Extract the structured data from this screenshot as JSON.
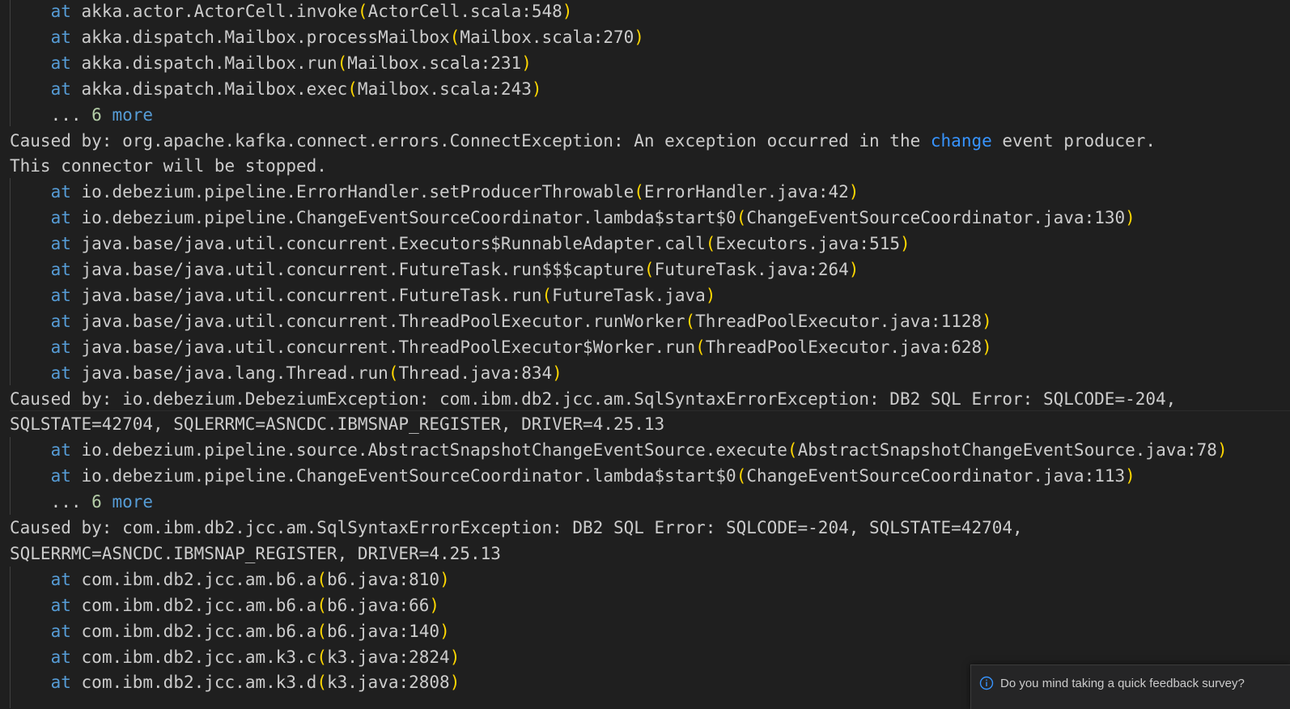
{
  "colors": {
    "background": "#1f1f1f",
    "text": "#cccccc",
    "keyword": "#569cd6",
    "number": "#b5cea8",
    "bracket": "#ffd700",
    "link_keyword": "#3794ff"
  },
  "terminal": {
    "lines": [
      {
        "indent": true,
        "at": "at",
        "text": "akka.actor.ActorCell.invoke",
        "loc": "ActorCell.scala:548"
      },
      {
        "indent": true,
        "at": "at",
        "text": "akka.dispatch.Mailbox.processMailbox",
        "loc": "Mailbox.scala:270"
      },
      {
        "indent": true,
        "at": "at",
        "text": "akka.dispatch.Mailbox.run",
        "loc": "Mailbox.scala:231"
      },
      {
        "indent": true,
        "at": "at",
        "text": "akka.dispatch.Mailbox.exec",
        "loc": "Mailbox.scala:243"
      },
      {
        "indent": true,
        "more_prefix": "... ",
        "more_num": "6",
        "more_word": "more"
      },
      {
        "indent": false,
        "plain_a": "Caused by: org.apache.kafka.connect.errors.ConnectException: An exception occurred in the ",
        "kw": "change",
        "plain_b": " event producer."
      },
      {
        "indent": false,
        "plain_a": "This connector will be stopped."
      },
      {
        "indent": true,
        "at": "at",
        "text": "io.debezium.pipeline.ErrorHandler.setProducerThrowable",
        "loc": "ErrorHandler.java:42"
      },
      {
        "indent": true,
        "at": "at",
        "text": "io.debezium.pipeline.ChangeEventSourceCoordinator.lambda$start$0",
        "loc": "ChangeEventSourceCoordinator.java:130"
      },
      {
        "indent": true,
        "at": "at",
        "text": "java.base/java.util.concurrent.Executors$RunnableAdapter.call",
        "loc": "Executors.java:515"
      },
      {
        "indent": true,
        "at": "at",
        "text": "java.base/java.util.concurrent.FutureTask.run$$$capture",
        "loc": "FutureTask.java:264"
      },
      {
        "indent": true,
        "at": "at",
        "text": "java.base/java.util.concurrent.FutureTask.run",
        "loc": "FutureTask.java"
      },
      {
        "indent": true,
        "at": "at",
        "text": "java.base/java.util.concurrent.ThreadPoolExecutor.runWorker",
        "loc": "ThreadPoolExecutor.java:1128"
      },
      {
        "indent": true,
        "at": "at",
        "text": "java.base/java.util.concurrent.ThreadPoolExecutor$Worker.run",
        "loc": "ThreadPoolExecutor.java:628"
      },
      {
        "indent": true,
        "at": "at",
        "text": "java.base/java.lang.Thread.run",
        "loc": "Thread.java:834"
      },
      {
        "indent": false,
        "plain_a": "Caused by: io.debezium.DebeziumException: com.ibm.db2.jcc.am.SqlSyntaxErrorException: DB2 SQL Error: SQLCODE=-204,"
      },
      {
        "indent": false,
        "plain_a": "SQLSTATE=42704, SQLERRMC=ASNCDC.IBMSNAP_REGISTER, DRIVER=4.25.13"
      },
      {
        "indent": true,
        "at": "at",
        "text": "io.debezium.pipeline.source.AbstractSnapshotChangeEventSource.execute",
        "loc": "AbstractSnapshotChangeEventSource.java:78"
      },
      {
        "indent": true,
        "at": "at",
        "text": "io.debezium.pipeline.ChangeEventSourceCoordinator.lambda$start$0",
        "loc": "ChangeEventSourceCoordinator.java:113"
      },
      {
        "indent": true,
        "more_prefix": "... ",
        "more_num": "6",
        "more_word": "more"
      },
      {
        "indent": false,
        "plain_a": "Caused by: com.ibm.db2.jcc.am.SqlSyntaxErrorException: DB2 SQL Error: SQLCODE=-204, SQLSTATE=42704,"
      },
      {
        "indent": false,
        "plain_a": "SQLERRMC=ASNCDC.IBMSNAP_REGISTER, DRIVER=4.25.13"
      },
      {
        "indent": true,
        "at": "at",
        "text": "com.ibm.db2.jcc.am.b6.a",
        "loc": "b6.java:810"
      },
      {
        "indent": true,
        "at": "at",
        "text": "com.ibm.db2.jcc.am.b6.a",
        "loc": "b6.java:66"
      },
      {
        "indent": true,
        "at": "at",
        "text": "com.ibm.db2.jcc.am.b6.a",
        "loc": "b6.java:140"
      },
      {
        "indent": true,
        "at": "at",
        "text": "com.ibm.db2.jcc.am.k3.c",
        "loc": "k3.java:2824"
      },
      {
        "indent": true,
        "at": "at",
        "text": "com.ibm.db2.jcc.am.k3.d",
        "loc": "k3.java:2808"
      }
    ]
  },
  "toast": {
    "icon": "info-icon",
    "message": "Do you mind taking a quick feedback survey?"
  }
}
